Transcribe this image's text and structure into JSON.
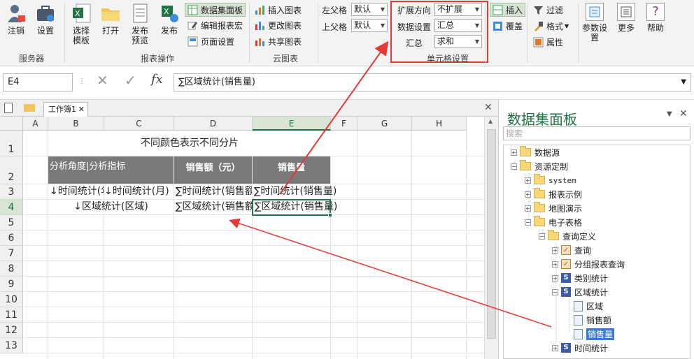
{
  "ribbon": {
    "server": {
      "logout": "注销",
      "settings": "设置",
      "group": "服务器"
    },
    "report": {
      "select": "选择",
      "select2": "模板",
      "open": "打开",
      "publish": "发布",
      "publish2": "预览",
      "publish3": "发布",
      "dataset": "数据集面板",
      "edit": "编辑报表宏",
      "page": "页面设置",
      "group": "报表操作"
    },
    "cloud": {
      "insert": "插入图表",
      "change": "更改图表",
      "share": "共享图表",
      "group": "云图表"
    },
    "parent": {
      "left": "左父格",
      "top": "上父格",
      "left_val": "默认",
      "top_val": "默认"
    },
    "cell": {
      "expand_label": "扩展方向",
      "expand_val": "不扩展",
      "data_label": "数据设置",
      "data_val": "汇总",
      "sum_label": "汇总",
      "sum_val": "求和",
      "group": "单元格设置"
    },
    "right": {
      "insert": "插入",
      "cover": "覆盖",
      "filter": "过滤",
      "format": "格式",
      "attr": "属性",
      "param": "参数设",
      "param2": "置",
      "more": "更多",
      "help": "帮助"
    }
  },
  "formula": {
    "cellref": "E4",
    "fx": "fx",
    "content": "∑区域统计(销售量)"
  },
  "sheet": {
    "tab": "工作簿1"
  },
  "grid": {
    "cols": [
      "A",
      "B",
      "C",
      "D",
      "E",
      "F",
      "G",
      "H"
    ],
    "rows": [
      "1",
      "2",
      "3",
      "4",
      "5",
      "6",
      "7",
      "8",
      "9",
      "10",
      "11",
      "12",
      "13"
    ],
    "title": "不同颜色表示不同分片",
    "header": {
      "b": "分析角度|分析指标",
      "d": "销售额（元）",
      "e": "销售量"
    },
    "r3": {
      "b": "↓时间统计(年",
      "c": "↓时间统计(月)",
      "d": "∑时间统计(销售额",
      "e": "∑时间统计(销售量)"
    },
    "r4": {
      "bc": "↓区域统计(区域)",
      "d": "∑区域统计(销售额",
      "e": "∑区域统计(销售量)"
    }
  },
  "panel": {
    "title": "数据集面板",
    "search_ph": "搜索",
    "tree": [
      "数据源",
      "资源定制",
      "system",
      "报表示例",
      "地图演示",
      "电子表格",
      "查询定义",
      "查询",
      "分组报表查询",
      "类别统计",
      "区域统计",
      "区域",
      "销售额",
      "销售量",
      "时间统计"
    ]
  },
  "colors": {
    "header_bg": "#7a7a7a",
    "accent": "#217346",
    "annotation": "#e53935"
  }
}
